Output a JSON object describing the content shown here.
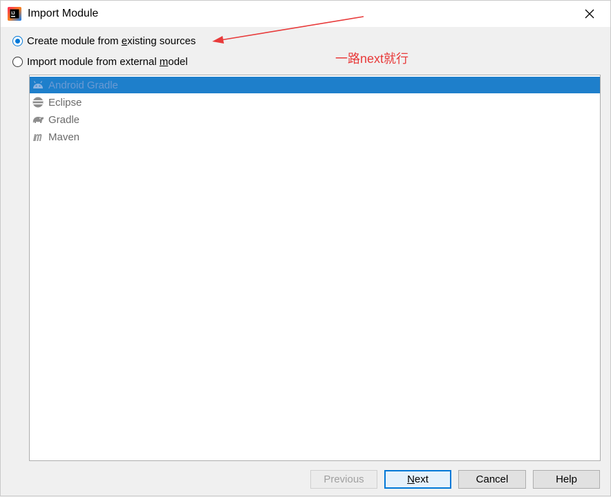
{
  "window": {
    "title": "Import Module",
    "app_icon": "intellij-icon",
    "close_icon": "close-icon"
  },
  "options": [
    {
      "pre": "Create module from ",
      "mnemonic": "e",
      "post": "xisting sources",
      "checked": true
    },
    {
      "pre": "Import module from external ",
      "mnemonic": "m",
      "post": "odel",
      "checked": false
    }
  ],
  "annotation": {
    "text": "一路next就行",
    "color": "#e83a3a"
  },
  "models": [
    {
      "label": "Android Gradle",
      "icon": "android-icon",
      "selected": true
    },
    {
      "label": "Eclipse",
      "icon": "eclipse-icon",
      "selected": false
    },
    {
      "label": "Gradle",
      "icon": "gradle-elephant-icon",
      "selected": false
    },
    {
      "label": "Maven",
      "icon": "maven-icon",
      "selected": false
    }
  ],
  "buttons": {
    "previous": "Previous",
    "next_mnemonic": "N",
    "next_rest": "ext",
    "cancel": "Cancel",
    "help": "Help"
  },
  "colors": {
    "selection": "#1e7fcb",
    "accent": "#0078d7"
  }
}
